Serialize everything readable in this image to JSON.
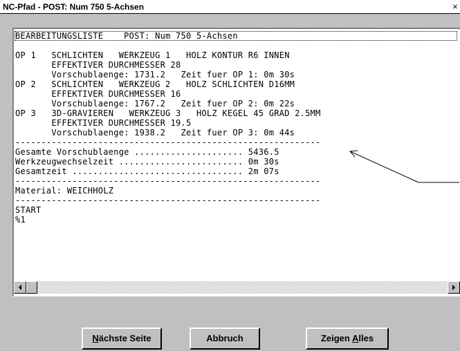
{
  "window": {
    "title": "NC-Pfad - POST: Num 750 5-Achsen",
    "close_glyph": "×"
  },
  "list": {
    "lines": [
      "BEARBEITUNGSLISTE    POST: Num 750 5-Achsen",
      "",
      "OP 1   SCHLICHTEN   WERKZEUG 1   HOLZ KONTUR R6 INNEN",
      "       EFFEKTIVER DURCHMESSER 28",
      "       Vorschublaenge: 1731.2   Zeit fuer OP 1: 0m 30s",
      "OP 2   SCHLICHTEN   WERKZEUG 2   HOLZ SCHLICHTEN D16MM",
      "       EFFEKTIVER DURCHMESSER 16",
      "       Vorschublaenge: 1767.2   Zeit fuer OP 2: 0m 22s",
      "OP 3   3D-GRAVIEREN   WERKZEUG 3   HOLZ KEGEL 45 GRAD 2.5MM",
      "       EFFEKTIVER DURCHMESSER 19.5",
      "       Vorschublaenge: 1938.2   Zeit fuer OP 3: 0m 44s",
      "-----------------------------------------------------------",
      "Gesamte Vorschublaenge ..................... 5436.5",
      "Werkzeugwechselzeit ........................ 0m 30s",
      "Gesamtzeit ................................. 2m 07s",
      "-----------------------------------------------------------",
      "Material: WEICHHOLZ",
      "-----------------------------------------------------------",
      "START",
      "%1"
    ]
  },
  "buttons": {
    "next_label_accel": "N",
    "next_label_rest": "ächste Seite",
    "cancel_label": "Abbruch",
    "show_label_start": "Zeigen ",
    "show_label_accel": "A",
    "show_label_rest": "lles"
  },
  "icons": {
    "close": "close-icon",
    "scroll_left": "scroll-left-arrow-icon",
    "scroll_right": "scroll-right-arrow-icon",
    "callout": "callout-arrow-icon"
  }
}
